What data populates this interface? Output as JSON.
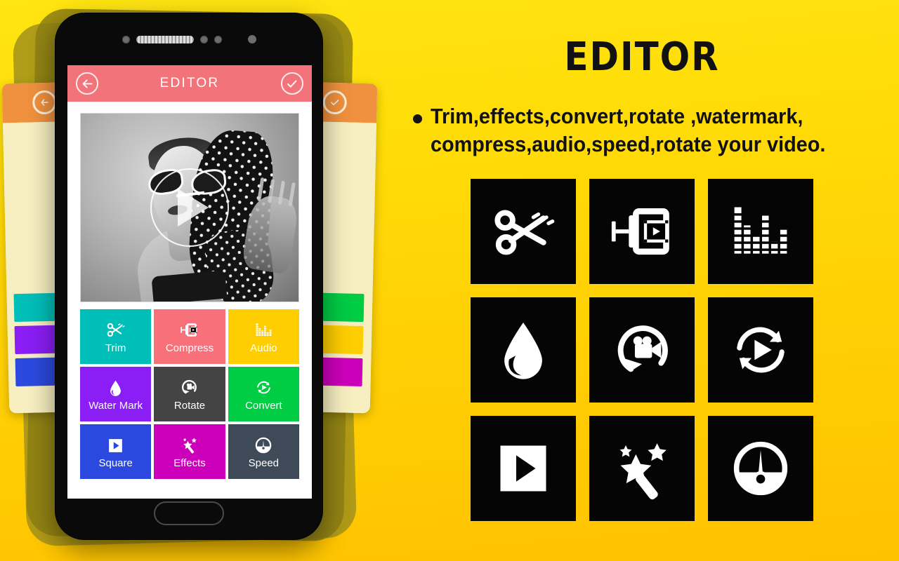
{
  "phone": {
    "app_bar": {
      "back_icon": "back-arrow-icon",
      "title": "EDITOR",
      "confirm_icon": "check-circle-icon"
    },
    "preview": {
      "play_icon": "play-circle-icon",
      "description": "black and white photo of woman with sunglasses and polka dot headscarf"
    },
    "tools": [
      {
        "label": "Trim",
        "icon": "scissors-icon",
        "color": "#00BFB8"
      },
      {
        "label": "Compress",
        "icon": "compress-icon",
        "color": "#F8717A"
      },
      {
        "label": "Audio",
        "icon": "equalizer-icon",
        "color": "#FFCE00"
      },
      {
        "label": "Water Mark",
        "icon": "water-drop-icon",
        "color": "#8A1EF5"
      },
      {
        "label": "Rotate",
        "icon": "rotate-camera-icon",
        "color": "#444444"
      },
      {
        "label": "Convert",
        "icon": "convert-icon",
        "color": "#00CC44"
      },
      {
        "label": "Square",
        "icon": "square-play-icon",
        "color": "#2B49DE"
      },
      {
        "label": "Effects",
        "icon": "magic-wand-icon",
        "color": "#CC00BB"
      },
      {
        "label": "Speed",
        "icon": "speedometer-icon",
        "color": "#3E4A57"
      }
    ],
    "peek_screens": {
      "left_bar_icon": "back-arrow-icon",
      "right_bar_icon": "check-circle-icon",
      "bar_color": "#F0913F"
    },
    "home_button": "home-button"
  },
  "promo": {
    "title": "EDITOR",
    "bullet_line_1": "Trim,effects,convert,rotate ,watermark,",
    "bullet_line_2": "compress,audio,speed,rotate your video.",
    "icons": [
      "scissors-icon",
      "compress-icon",
      "equalizer-icon",
      "water-drop-icon",
      "rotate-camera-icon",
      "convert-icon",
      "square-play-icon",
      "magic-wand-icon",
      "speedometer-icon"
    ]
  },
  "theme": {
    "background_top": "#FFE512",
    "background_bottom": "#FFC200",
    "app_bar_color": "#F2737A",
    "icon_tile_bg": "#050505",
    "text_color": "#111111"
  }
}
